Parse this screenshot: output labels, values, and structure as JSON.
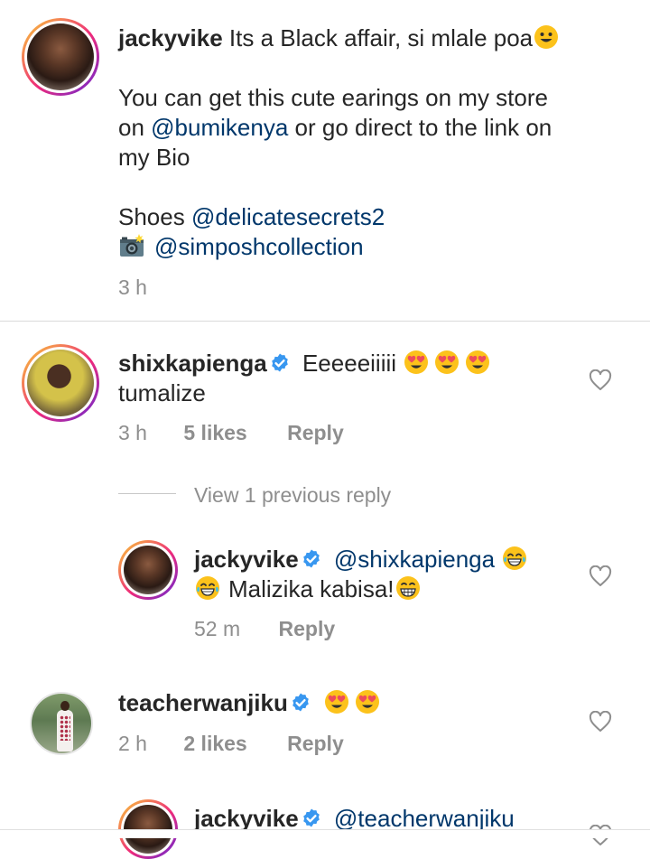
{
  "caption": {
    "username": "jackyvike",
    "line1": "Its a Black affair, si mlale poa",
    "line2": "You can get this cute earings on my store",
    "line3_pre": "on ",
    "line3_mention": "@bumikenya",
    "line3_post": " or go direct to the link on",
    "line4": "my Bio",
    "line5_pre": "Shoes ",
    "line5_mention": "@delicatesecrets2",
    "line6_mention": "@simposhcollection",
    "time": "3 h"
  },
  "comment1": {
    "username": "shixkapienga",
    "text_a": "Eeeeeiiiii",
    "text_b": "tumalize",
    "time": "3 h",
    "likes": "5 likes",
    "reply": "Reply"
  },
  "view_replies": "View 1 previous reply",
  "reply1": {
    "username": "jackyvike",
    "mention": "@shixkapienga",
    "text": "Malizika kabisa!",
    "time": "52 m",
    "reply": "Reply"
  },
  "comment2": {
    "username": "teacherwanjiku",
    "time": "2 h",
    "likes": "2 likes",
    "reply": "Reply"
  },
  "reply2": {
    "username": "jackyvike",
    "mention": "@teacherwanjiku"
  },
  "colors": {
    "text": "#262626",
    "muted": "#8e8e8e",
    "mention": "#00376b",
    "verified": "#3897f0",
    "divider": "#dbdbdb"
  }
}
